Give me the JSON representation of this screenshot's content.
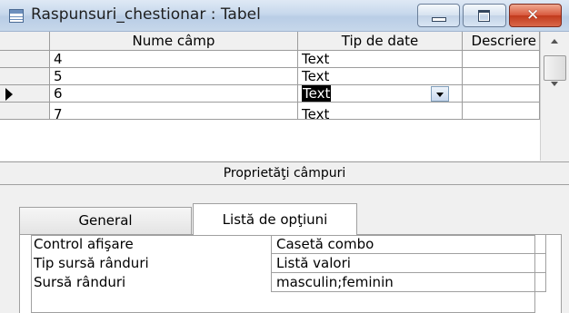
{
  "window": {
    "title": "Raspunsuri_chestionar : Tabel",
    "buttons": {
      "minimize": "minimize",
      "maximize": "maximize",
      "close": "close"
    }
  },
  "grid": {
    "columns": [
      "Nume câmp",
      "Tip de date",
      "Descriere"
    ],
    "rows": [
      {
        "name": "4",
        "type": "Text",
        "description": "",
        "current": false
      },
      {
        "name": "5",
        "type": "Text",
        "description": "",
        "current": false
      },
      {
        "name": "6",
        "type": "Text",
        "description": "",
        "current": true
      },
      {
        "name": "7",
        "type": "Text",
        "description": "",
        "current": false
      }
    ]
  },
  "properties": {
    "title": "Proprietăţi câmpuri",
    "tabs": [
      {
        "label": "General",
        "active": false
      },
      {
        "label": "Listă de opţiuni",
        "active": true
      }
    ],
    "rows": [
      {
        "label": "Control afişare",
        "value": "Casetă combo"
      },
      {
        "label": "Tip sursă rânduri",
        "value": "Listă valori"
      },
      {
        "label": "Sursă rânduri",
        "value": "masculin;feminin"
      }
    ]
  },
  "colors": {
    "close_button": "#c23a1c",
    "selection": "#000000"
  }
}
